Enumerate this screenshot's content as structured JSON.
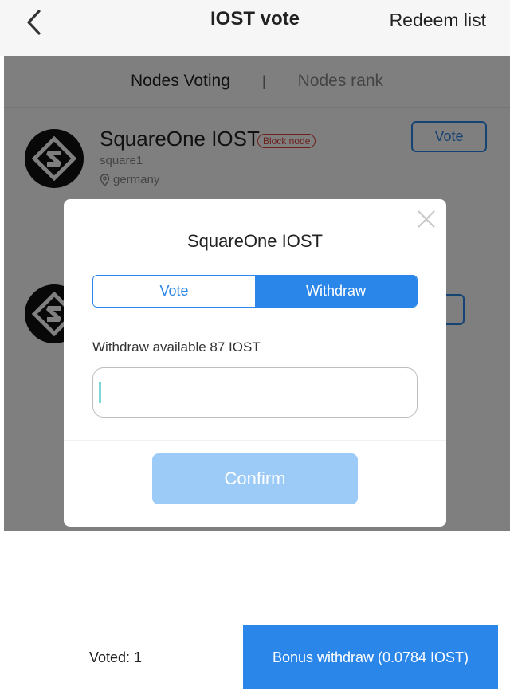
{
  "header": {
    "back_icon": "chevron-left-icon",
    "title": "IOST vote",
    "redeem_label": "Redeem list"
  },
  "tabs": [
    {
      "label": "Nodes Voting",
      "active": true
    },
    {
      "label": "Nodes rank",
      "active": false
    }
  ],
  "tab_separator": "|",
  "nodes": [
    {
      "name": "SquareOne IOST",
      "badge": "Block node",
      "subname": "square1",
      "location": "germany",
      "vote_label": "Vote",
      "logo_icon": "squareone-logo-icon"
    },
    {
      "logo_icon": "squareone-logo-icon"
    }
  ],
  "modal": {
    "title": "SquareOne IOST",
    "segments": [
      {
        "label": "Vote",
        "selected": false
      },
      {
        "label": "Withdraw",
        "selected": true
      }
    ],
    "available_text": "Withdraw available 87 IOST",
    "input_value": "",
    "confirm_label": "Confirm",
    "close_icon": "close-icon"
  },
  "footer": {
    "voted_text": "Voted: 1",
    "bonus_label": "Bonus withdraw (0.0784 IOST)"
  },
  "colors": {
    "accent": "#2a86e8",
    "confirm_disabled": "#9ccbf7",
    "badge": "#d9423b"
  }
}
